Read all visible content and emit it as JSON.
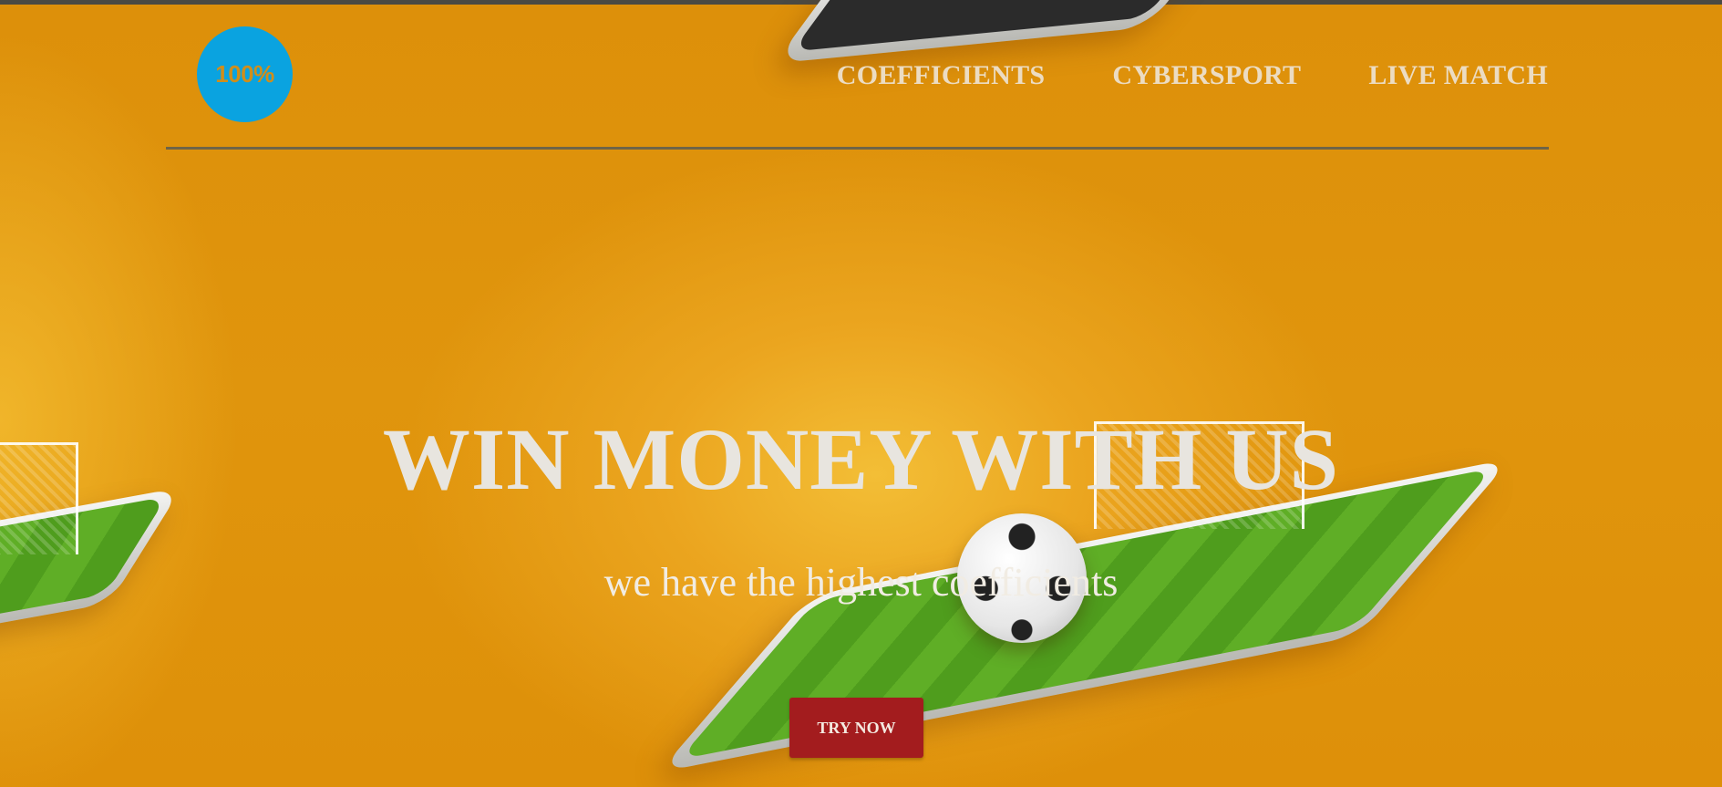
{
  "header": {
    "logo_text": "100%",
    "nav": [
      {
        "label": "COEFFICIENTS"
      },
      {
        "label": "CYBERSPORT"
      },
      {
        "label": "LIVE MATCH"
      }
    ]
  },
  "hero": {
    "title": "WIN MONEY WITH US",
    "subtitle": "we have the highest coefficients",
    "cta_label": "TRY NOW"
  },
  "colors": {
    "background": "#de9009",
    "logo": "#0aa3e0",
    "cta": "#a31c1e",
    "nav_text": "#ecdcc2"
  }
}
